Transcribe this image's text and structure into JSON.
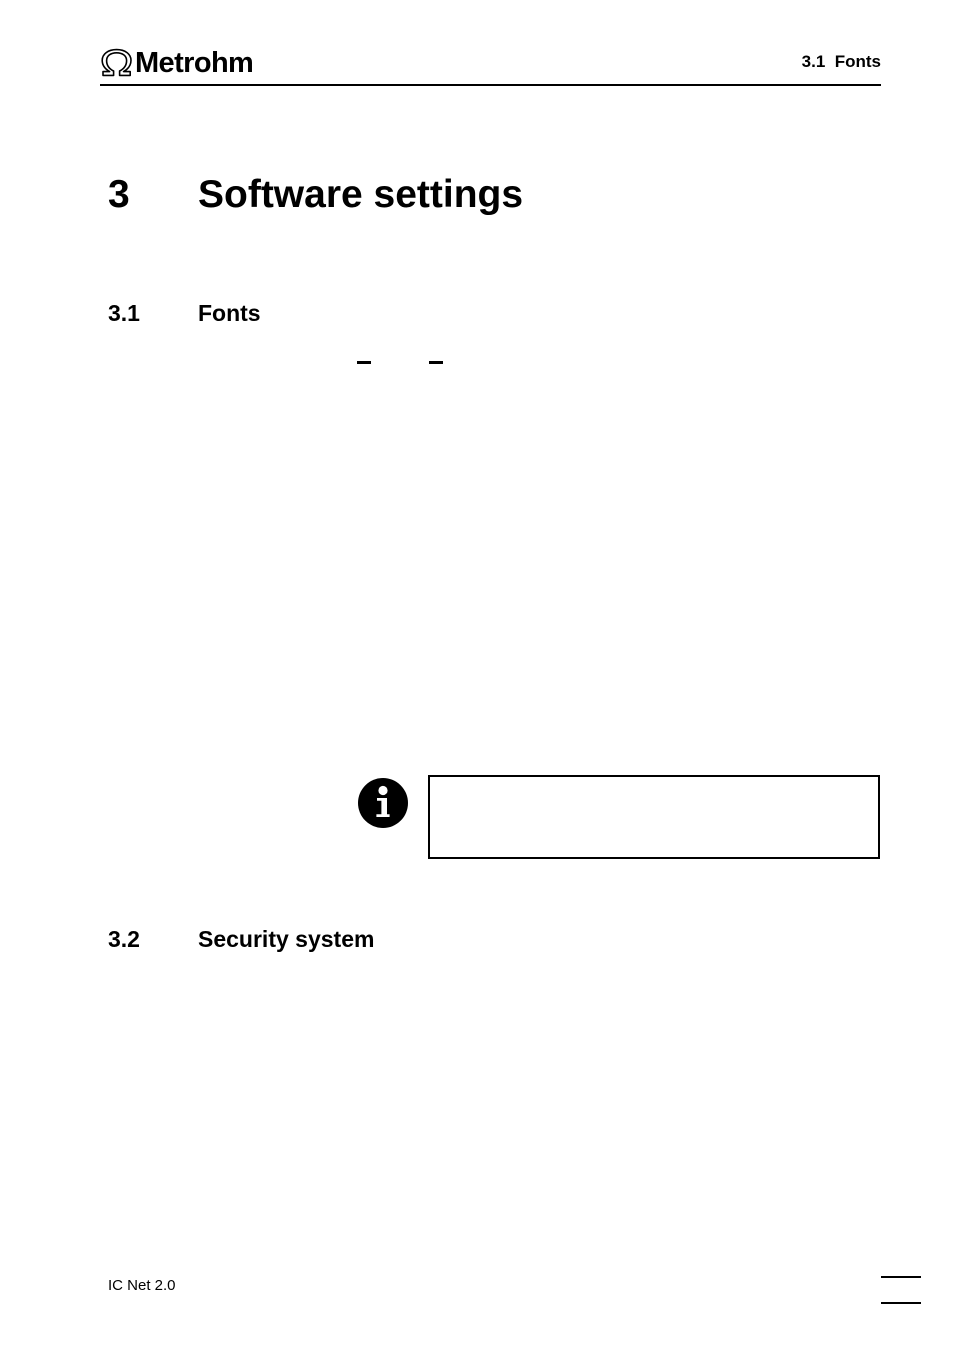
{
  "document": {
    "product": "IC Net 2.0",
    "brand": "Metrohm",
    "brand_mark": "omega-symbol"
  },
  "header": {
    "section_reference": "3.1  Fonts"
  },
  "chapter": {
    "number": "3",
    "title": "Software settings"
  },
  "sections": [
    {
      "number": "3.1",
      "title": "Fonts"
    },
    {
      "number": "3.2",
      "title": "Security system"
    }
  ],
  "marks": {
    "dash_one": "–",
    "dash_two": "–"
  },
  "note": {
    "icon": "info-icon",
    "text": ""
  },
  "footer": {
    "document_label": "IC Net 2.0",
    "page_number": ""
  }
}
